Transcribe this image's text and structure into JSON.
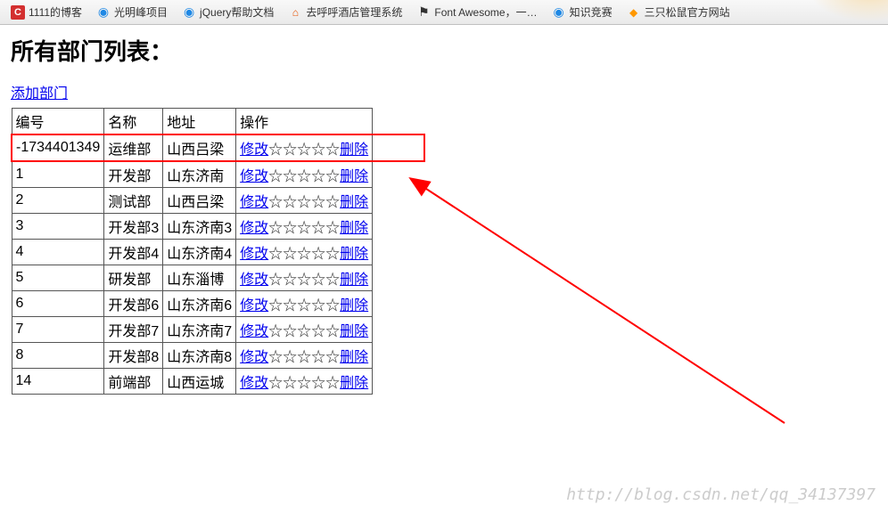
{
  "bookmarks": [
    {
      "icon": "C",
      "iconClass": "ico-c",
      "label": "1111的博客"
    },
    {
      "icon": "◉",
      "iconClass": "ico-ie",
      "label": "光明峰项目"
    },
    {
      "icon": "◉",
      "iconClass": "ico-ie",
      "label": "jQuery帮助文档"
    },
    {
      "icon": "⌂",
      "iconClass": "ico-h",
      "label": "去呼呼酒店管理系统"
    },
    {
      "icon": "⚑",
      "iconClass": "ico-f",
      "label": "Font Awesome，一…"
    },
    {
      "icon": "◉",
      "iconClass": "ico-ie",
      "label": "知识竞赛"
    },
    {
      "icon": "◆",
      "iconClass": "ico-m",
      "label": "三只松鼠官方网站"
    }
  ],
  "page": {
    "title": "所有部门列表：",
    "add_link": "添加部门"
  },
  "table": {
    "headers": [
      "编号",
      "名称",
      "地址",
      "操作"
    ],
    "action_edit": "修改",
    "action_stars": "☆☆☆☆☆",
    "action_delete": "删除",
    "rows": [
      {
        "id": "-1734401349",
        "name": "运维部",
        "addr": "山西吕梁",
        "highlighted": true
      },
      {
        "id": "1",
        "name": "开发部",
        "addr": "山东济南"
      },
      {
        "id": "2",
        "name": "测试部",
        "addr": "山西吕梁"
      },
      {
        "id": "3",
        "name": "开发部3",
        "addr": "山东济南3"
      },
      {
        "id": "4",
        "name": "开发部4",
        "addr": "山东济南4"
      },
      {
        "id": "5",
        "name": "研发部",
        "addr": "山东淄博"
      },
      {
        "id": "6",
        "name": "开发部6",
        "addr": "山东济南6"
      },
      {
        "id": "7",
        "name": "开发部7",
        "addr": "山东济南7"
      },
      {
        "id": "8",
        "name": "开发部8",
        "addr": "山东济南8"
      },
      {
        "id": "14",
        "name": "前端部",
        "addr": "山西运城"
      }
    ]
  },
  "watermark": "http://blog.csdn.net/qq_34137397"
}
